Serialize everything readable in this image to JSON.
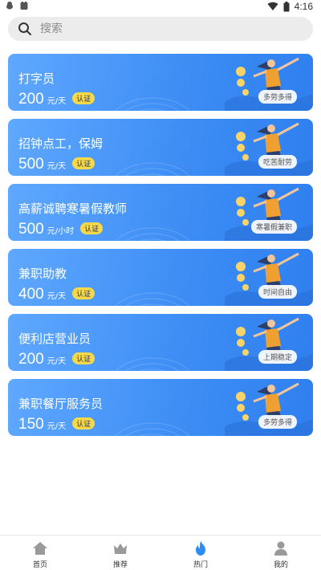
{
  "status": {
    "time": "4:16"
  },
  "search": {
    "placeholder": "搜索"
  },
  "jobs": [
    {
      "title": "打字员",
      "amount": "200",
      "unit": "元/天",
      "badge": "认证",
      "tag": "多劳多得"
    },
    {
      "title": "招钟点工，保姆",
      "amount": "500",
      "unit": "元/天",
      "badge": "认证",
      "tag": "吃苦耐劳"
    },
    {
      "title": "高薪诚聘寒暑假教师",
      "amount": "500",
      "unit": "元/小时",
      "badge": "认证",
      "tag": "寒暑假兼职"
    },
    {
      "title": "兼职助教",
      "amount": "400",
      "unit": "元/天",
      "badge": "认证",
      "tag": "时间自由"
    },
    {
      "title": "便利店营业员",
      "amount": "200",
      "unit": "元/天",
      "badge": "认证",
      "tag": "上期稳定"
    },
    {
      "title": "兼职餐厅服务员",
      "amount": "150",
      "unit": "元/天",
      "badge": "认证",
      "tag": "多劳多得"
    }
  ],
  "tabs": [
    {
      "label": "首页",
      "icon": "home-icon",
      "color": "#9a9a9a"
    },
    {
      "label": "推荐",
      "icon": "crown-icon",
      "color": "#9a9a9a"
    },
    {
      "label": "热门",
      "icon": "flame-icon",
      "color": "#2f8cf5"
    },
    {
      "label": "我的",
      "icon": "person-icon",
      "color": "#9a9a9a"
    }
  ]
}
